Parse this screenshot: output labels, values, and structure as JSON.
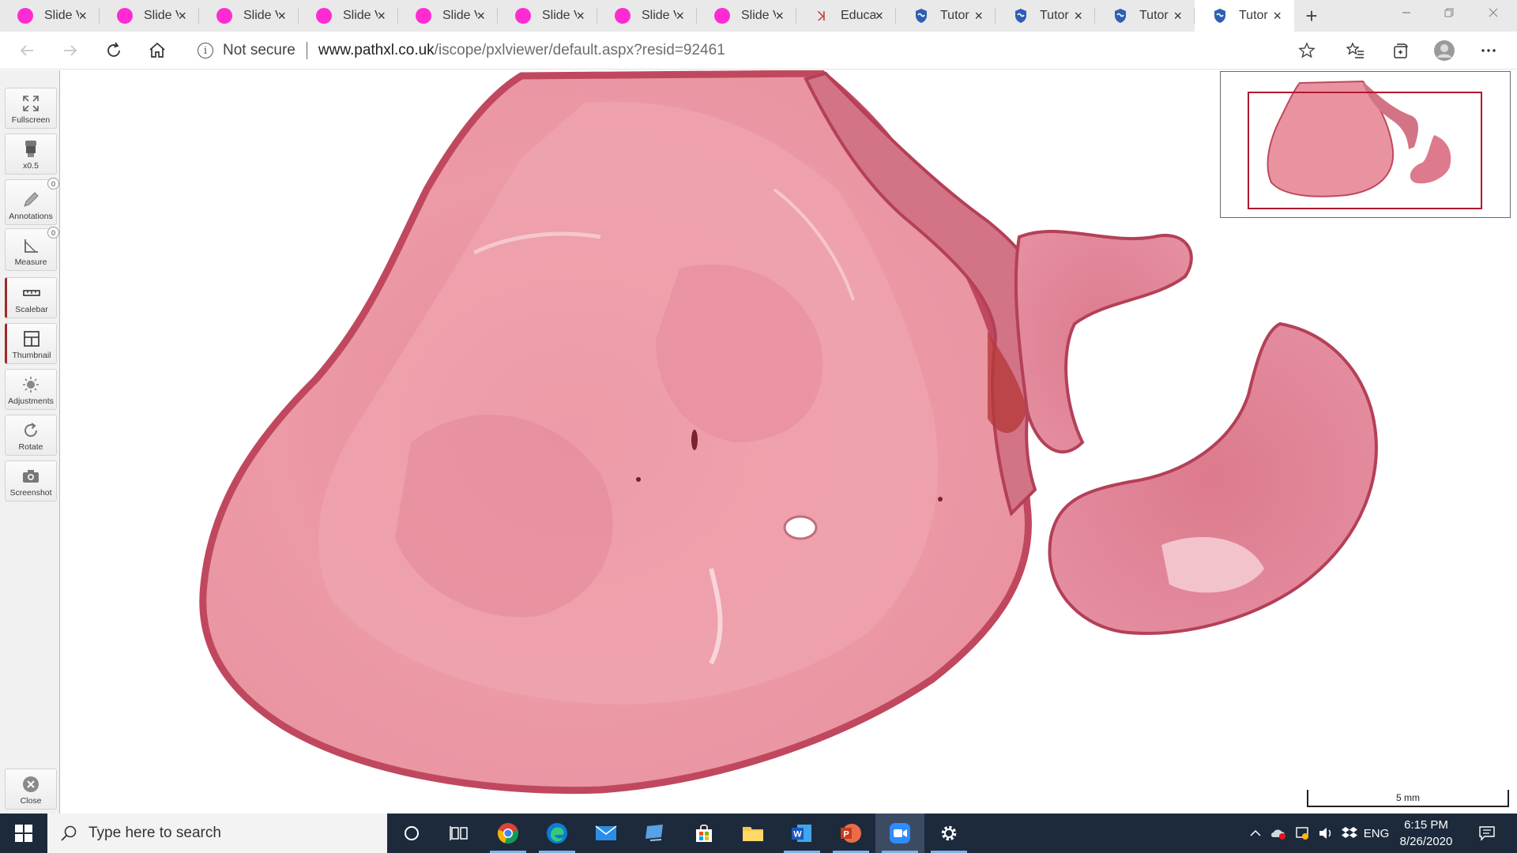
{
  "browser": {
    "tabs": [
      {
        "label": "Slide Viewer",
        "icon": "pink-dot-icon",
        "active": false
      },
      {
        "label": "Slide Viewer",
        "icon": "pink-dot-icon",
        "active": false
      },
      {
        "label": "Slide Viewer",
        "icon": "pink-dot-icon",
        "active": false
      },
      {
        "label": "Slide Viewer",
        "icon": "pink-dot-icon",
        "active": false
      },
      {
        "label": "Slide Viewer",
        "icon": "pink-dot-icon",
        "active": false
      },
      {
        "label": "Slide Viewer",
        "icon": "pink-dot-icon",
        "active": false
      },
      {
        "label": "Slide Viewer",
        "icon": "pink-dot-icon",
        "active": false
      },
      {
        "label": "Slide Viewer",
        "icon": "pink-dot-icon",
        "active": false
      },
      {
        "label": "Educat",
        "icon": "education-icon",
        "active": false
      },
      {
        "label": "Tutor",
        "icon": "shield-icon",
        "active": false
      },
      {
        "label": "Tutor",
        "icon": "shield-icon",
        "active": false
      },
      {
        "label": "Tutor",
        "icon": "shield-icon",
        "active": false
      },
      {
        "label": "Tutor",
        "icon": "shield-icon",
        "active": true
      }
    ],
    "close_glyph": "×",
    "new_tab_glyph": "+",
    "security_label": "Not secure",
    "url_domain": "www.pathxl.co.uk",
    "url_path": "/iscope/pxlviewer/default.aspx?resid=92461"
  },
  "viewer": {
    "tools": [
      {
        "label": "Fullscreen",
        "icon": "fullscreen-icon"
      },
      {
        "label": "x0.5",
        "icon": "objective-lens-icon"
      },
      {
        "label": "Annotations",
        "icon": "pencil-icon",
        "count": "0"
      },
      {
        "label": "Measure",
        "icon": "ruler-angle-icon",
        "count": "0"
      },
      {
        "label": "Scalebar",
        "icon": "scalebar-icon",
        "active": true
      },
      {
        "label": "Thumbnail",
        "icon": "thumbnail-icon",
        "active": true
      },
      {
        "label": "Adjustments",
        "icon": "sun-icon"
      },
      {
        "label": "Rotate",
        "icon": "rotate-icon"
      },
      {
        "label": "Screenshot",
        "icon": "camera-icon"
      }
    ],
    "close_tool": {
      "label": "Close",
      "icon": "close-circle-icon"
    },
    "scalebar_label": "5 mm",
    "tissue_color": "#e8909b",
    "tissue_edge_color": "#c0485e",
    "overview_frame_color": "#b0182e"
  },
  "taskbar": {
    "search_placeholder": "Type here to search",
    "apps": [
      "cortana-icon",
      "task-view-icon",
      "chrome-icon",
      "edge-icon",
      "mail-icon",
      "remote-desktop-icon",
      "store-icon",
      "file-explorer-icon",
      "word-icon",
      "powerpoint-icon",
      "zoom-icon",
      "settings-icon"
    ],
    "language": "ENG",
    "time": "6:15 PM",
    "date": "8/26/2020"
  }
}
